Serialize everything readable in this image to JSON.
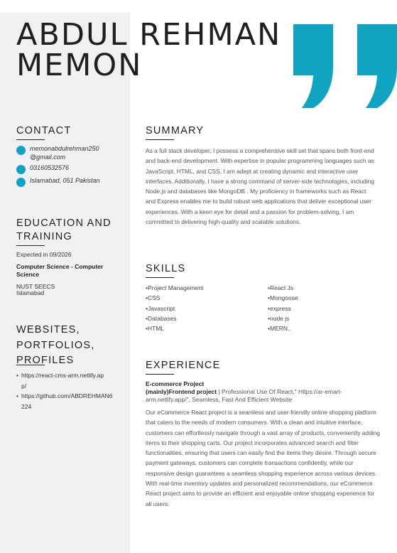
{
  "name": {
    "line1": "ABDUL REHMAN",
    "line2": "MEMON"
  },
  "colors": {
    "accent": "#0ea4c2",
    "sidebar_bg": "#f1f1f1"
  },
  "contact": {
    "title": "CONTACT",
    "email": "memonabdulrehman250@gmail.com",
    "phone": "03160532576",
    "location": "Islamabad, 051 Pakistan"
  },
  "education": {
    "title": "EDUCATION AND TRAINING",
    "expected": "Expected in 09/2026",
    "degree": "Computer Science - Computer Science",
    "school": "NUST SEECS",
    "city": "Islamabad"
  },
  "websites": {
    "title": "WEBSITES, PORTFOLIOS, PROFILES",
    "links": [
      "https://react-cms-arm.netlify.app/",
      "https://github.com/ABDREHMAN6224"
    ]
  },
  "summary": {
    "title": "SUMMARY",
    "text": "As a full stack developer, I possess a comprehensive skill set that spans both front-end and back-end development. With expertise in popular programming languages such as JavaScript, HTML, and CSS, I am adept at creating dynamic and interactive user interfaces. Additionally, I have a strong command of server-side technologies, including Node.js and databases like MongoDB . My proficiency in frameworks such as React and Express enables me to build robust web applications that deliver exceptional user experiences. With a keen eye for detail and a passion for problem-solving, I am committed to delivering high-quality and scalable solutions."
  },
  "skills": {
    "title": "SKILLS",
    "left": [
      "Project Management",
      "CSS",
      "Javascript",
      "Databases",
      "HTML"
    ],
    "right": [
      "React Js",
      "Mongoose",
      "express",
      "node js",
      "MERN.."
    ]
  },
  "experience": {
    "title": "EXPERIENCE",
    "job_title": "E-commerce Project",
    "role": "(mainly)Frontend project",
    "meta": " | Professional Use Of React,\" Https://ar-emart-arm.netlify.app/\", Seamless, Fast And Efficient Website",
    "description": "Our eCommerce React project is a seamless and user-friendly online shopping platform that caters to the needs of modern consumers. With a clean and intuitive interface, customers can effortlessly navigate through a vast array of products, conveniently adding items to their shopping carts. Our project incorporates advanced search and filter functionalities, ensuring that users can easily find the items they desire. Through secure payment gateways, customers can complete transactions confidently, while our responsive design guarantees a seamless shopping experience across various devices. With real-time inventory updates and personalized recommendations, our eCommerce React project aims to provide an efficient and enjoyable online shopping experience for all users."
  }
}
